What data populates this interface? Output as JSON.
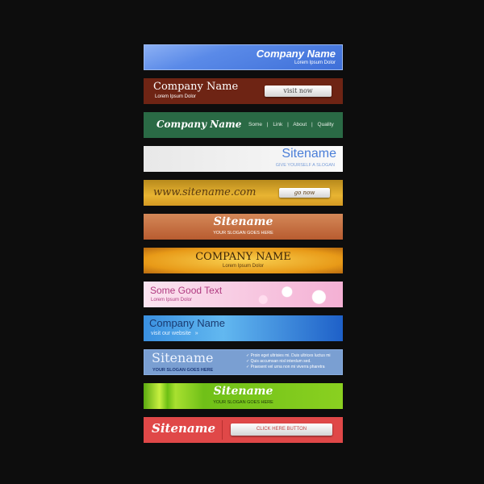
{
  "banners": [
    {
      "title": "Company Name",
      "subtitle": "Lorem Ipsum Dolor",
      "color": "#4f7fe0"
    },
    {
      "title": "Company Name",
      "subtitle": "Lorem Ipsum Dolor",
      "button": "visit now",
      "color": "#6e2414"
    },
    {
      "title": "Company Name",
      "links": [
        "Some",
        "|",
        "Link",
        "|",
        "About",
        "|",
        "Quality"
      ],
      "color": "#2a6a45"
    },
    {
      "title": "Sitename",
      "subtitle": "GIVE YOURSELF A SLOGAN",
      "color": "#f2f2f2"
    },
    {
      "title": "www.sitename.com",
      "button": "go now",
      "color": "#d49a22"
    },
    {
      "title": "Sitename",
      "subtitle": "YOUR SLOGAN GOES HERE",
      "color": "#c0683a"
    },
    {
      "title": "COMPANY NAME",
      "subtitle": "Lorem Ipsum Dolor",
      "color": "#f0a820"
    },
    {
      "title": "Some Good Text",
      "subtitle": "Lorem Ipsum Dolor",
      "color": "#f6c0dc"
    },
    {
      "title": "Company Name",
      "subtitle": "visit our website",
      "arrow": "»",
      "color": "#2a78d8"
    },
    {
      "title": "Sitename",
      "subtitle": "YOUR SLOGAN GOES HERE",
      "bullets": [
        "✓ Proin eget ultrisies mi. Duis ultrices luctus mi",
        "✓ Quis accumsan nisl interdum sed.",
        "✓ Praesent vel urna non mi viverra pharetra"
      ],
      "color": "#7a9fd2"
    },
    {
      "title": "Sitename",
      "subtitle": "YOUR SLOGAN GOES HERE",
      "color": "#6cbf14"
    },
    {
      "title": "Sitename",
      "button": "CLICK HERE  BUTTON",
      "color": "#e04848"
    }
  ]
}
